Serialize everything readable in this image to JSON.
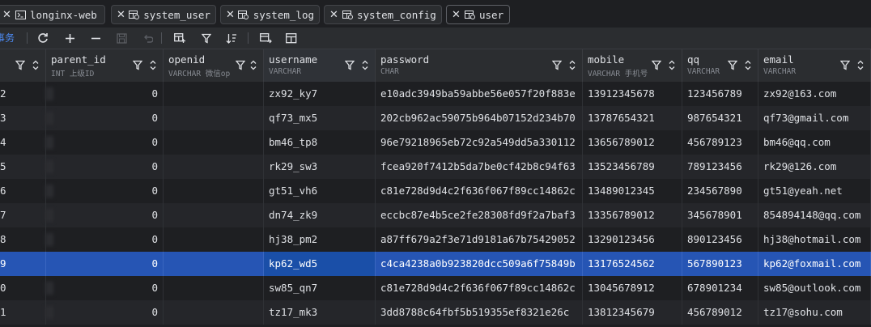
{
  "tabs": [
    {
      "label": "longinx-web",
      "icon": "console-icon"
    },
    {
      "label": "system_user",
      "icon": "table-icon"
    },
    {
      "label": "system_log",
      "icon": "table-icon"
    },
    {
      "label": "system_config",
      "icon": "table-icon"
    },
    {
      "label": "user",
      "icon": "table-icon",
      "active": true
    }
  ],
  "toolbar": {
    "tx_label": "事务",
    "buttons": [
      "refresh-icon",
      "add-row-icon",
      "delete-row-icon",
      "save-icon",
      "revert-icon",
      "view-icon",
      "filter-icon",
      "sort-icon",
      "compare-icon",
      "grid-icon"
    ]
  },
  "columns": [
    {
      "name": "",
      "type": ""
    },
    {
      "name": "parent_id",
      "type": "INT 上级ID"
    },
    {
      "name": "openid",
      "type": "VARCHAR 微信ope…"
    },
    {
      "name": "username",
      "type": "VARCHAR"
    },
    {
      "name": "password",
      "type": "CHAR"
    },
    {
      "name": "mobile",
      "type": "VARCHAR 手机号"
    },
    {
      "name": "qq",
      "type": "VARCHAR"
    },
    {
      "name": "email",
      "type": "VARCHAR"
    }
  ],
  "rows": [
    {
      "id": "2",
      "parent_id": "0",
      "openid": "",
      "username": "zx92_ky7",
      "password": "e10adc3949ba59abbe56e057f20f883e",
      "mobile": "13912345678",
      "qq": "123456789",
      "email": "zx92@163.com"
    },
    {
      "id": "3",
      "parent_id": "0",
      "openid": "",
      "username": "qf73_mx5",
      "password": "202cb962ac59075b964b07152d234b70",
      "mobile": "13787654321",
      "qq": "987654321",
      "email": "qf73@gmail.com"
    },
    {
      "id": "4",
      "parent_id": "0",
      "openid": "",
      "username": "bm46_tp8",
      "password": "96e79218965eb72c92a549dd5a330112",
      "mobile": "13656789012",
      "qq": "456789123",
      "email": "bm46@qq.com"
    },
    {
      "id": "5",
      "parent_id": "0",
      "openid": "",
      "username": "rk29_sw3",
      "password": "fcea920f7412b5da7be0cf42b8c94f63",
      "mobile": "13523456789",
      "qq": "789123456",
      "email": "rk29@126.com"
    },
    {
      "id": "6",
      "parent_id": "0",
      "openid": "",
      "username": "gt51_vh6",
      "password": "c81e728d9d4c2f636f067f89cc14862c",
      "mobile": "13489012345",
      "qq": "234567890",
      "email": "gt51@yeah.net"
    },
    {
      "id": "7",
      "parent_id": "0",
      "openid": "",
      "username": "dn74_zk9",
      "password": "eccbc87e4b5ce2fe28308fd9f2a7baf3",
      "mobile": "13356789012",
      "qq": "345678901",
      "email": "854894148@qq.com"
    },
    {
      "id": "8",
      "parent_id": "0",
      "openid": "",
      "username": "hj38_pm2",
      "password": "a87ff679a2f3e71d9181a67b75429052",
      "mobile": "13290123456",
      "qq": "890123456",
      "email": "hj38@hotmail.com"
    },
    {
      "id": "9",
      "parent_id": "0",
      "openid": "",
      "username": "kp62_wd5",
      "password": "c4ca4238a0b923820dcc509a6f75849b",
      "mobile": "13176524562",
      "qq": "567890123",
      "email": "kp62@foxmail.com",
      "selected": true
    },
    {
      "id": "0",
      "parent_id": "0",
      "openid": "",
      "username": "sw85_qn7",
      "password": "c81e728d9d4c2f636f067f89cc14862c",
      "mobile": "13045678912",
      "qq": "678901234",
      "email": "sw85@outlook.com"
    },
    {
      "id": "1",
      "parent_id": "0",
      "openid": "",
      "username": "tz17_mk3",
      "password": "3dd8788c64fbf5b519355ef8321e26c",
      "mobile": "13812345679",
      "qq": "456789012",
      "email": "tz17@sohu.com"
    }
  ],
  "colors": {
    "selection": "#2655b4",
    "accent": "#4c8bf5",
    "background": "#1e1f22"
  }
}
